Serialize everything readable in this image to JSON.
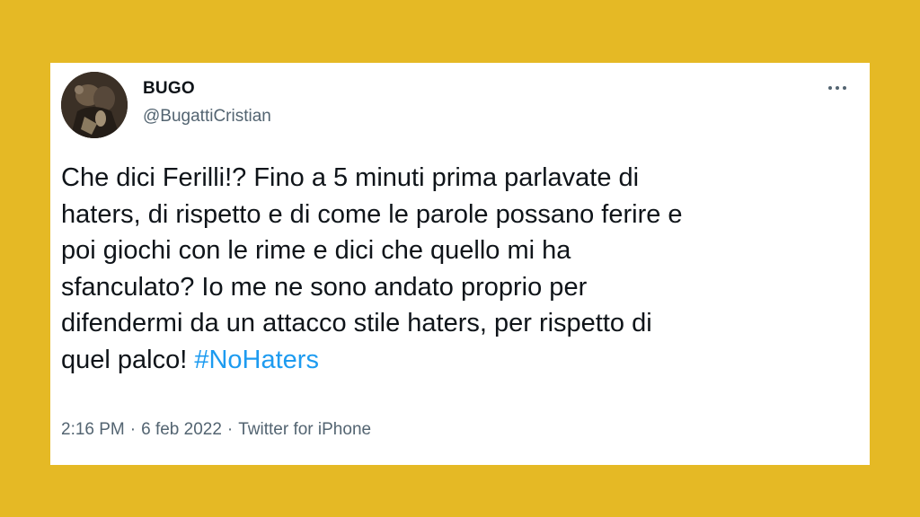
{
  "tweet": {
    "display_name": "BUGO",
    "handle": "@BugattiCristian",
    "text_lines": [
      "Che dici Ferilli!? Fino a 5 minuti prima parlavate di",
      "haters, di rispetto e di come le parole possano ferire e",
      "poi giochi con le rime e dici che quello mi ha",
      "sfanculato? Io me ne sono andato proprio per",
      "difendermi da un attacco stile haters, per rispetto di",
      "quel palco! "
    ],
    "hashtag": "#NoHaters",
    "time": "2:16 PM",
    "separator": "·",
    "date": "6 feb 2022",
    "source": "Twitter for iPhone"
  },
  "icons": {
    "more_menu": "more-horizontal-icon",
    "avatar": "profile-avatar"
  },
  "colors": {
    "background": "#E5B925",
    "card": "#FFFFFF",
    "text": "#0F1419",
    "secondary_text": "#536471",
    "link": "#1D9BF0"
  }
}
